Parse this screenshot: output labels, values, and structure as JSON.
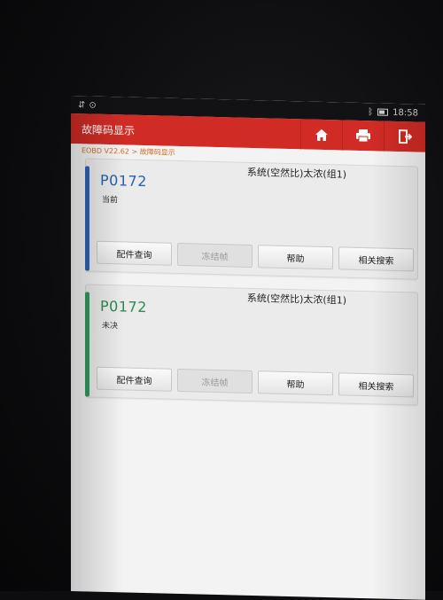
{
  "status_bar": {
    "left_icons": [
      "signal-icon",
      "vpn-icon"
    ],
    "bluetooth": "bluetooth-icon",
    "time": "18:58"
  },
  "header": {
    "title": "故障码显示",
    "actions": [
      "home-icon",
      "print-icon",
      "exit-icon"
    ]
  },
  "breadcrumb": "EOBD V22.62 > 故障码显示",
  "colors": {
    "header_red": "#d02b25",
    "breadcrumb_orange": "#d46b1f",
    "stripe_blue": "#2a63b8",
    "stripe_green": "#2e9a5c",
    "code_blue": "#2a5fb0",
    "code_green": "#2e8a55"
  },
  "dtcs": [
    {
      "code": "P0172",
      "status": "当前",
      "description": "系统(空然比)太浓(组1)",
      "buttons": [
        {
          "label": "配件查询",
          "enabled": true
        },
        {
          "label": "冻结帧",
          "enabled": false
        },
        {
          "label": "帮助",
          "enabled": true
        },
        {
          "label": "相关搜索",
          "enabled": true
        }
      ]
    },
    {
      "code": "P0172",
      "status": "未决",
      "description": "系统(空然比)太浓(组1)",
      "buttons": [
        {
          "label": "配件查询",
          "enabled": true
        },
        {
          "label": "冻结帧",
          "enabled": false
        },
        {
          "label": "帮助",
          "enabled": true
        },
        {
          "label": "相关搜索",
          "enabled": true
        }
      ]
    }
  ]
}
